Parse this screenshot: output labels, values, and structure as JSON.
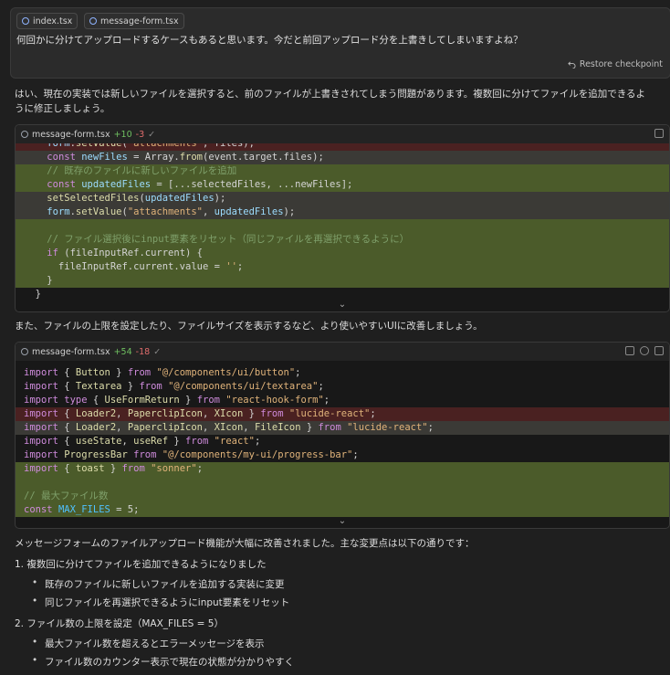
{
  "user_message": {
    "files": [
      "index.tsx",
      "message-form.tsx"
    ],
    "text": "何回かに分けてアップロードするケースもあると思います。今だと前回アップロード分を上書きしてしまいますよね？",
    "restore_label": "Restore checkpoint"
  },
  "response": {
    "para1_line1": "はい、現在の実装では新しいファイルを選択すると、前のファイルが上書きされてしまう問題があります。複数回に分けてファイルを追加できるよ",
    "para1_line2": "うに修正しましょう。",
    "para2": "また、ファイルの上限を設定したり、ファイルサイズを表示するなど、より使いやすいUIに改善しましょう。",
    "para3": "メッセージフォームのファイルアップロード機能が大幅に改善されました。主な変更点は以下の通りです：",
    "list": [
      {
        "title": "1. 複数回に分けてファイルを追加できるようになりました",
        "items": [
          "既存のファイルに新しいファイルを追加する実装に変更",
          "同じファイルを再選択できるようにinput要素をリセット"
        ]
      },
      {
        "title": "2. ファイル数の上限を設定（MAX_FILES = 5）",
        "items": [
          "最大ファイル数を超えるとエラーメッセージを表示",
          "ファイル数のカウンター表示で現在の状態が分かりやすく"
        ]
      }
    ]
  },
  "code_block_1": {
    "filename": "message-form.tsx",
    "added": "+10",
    "removed": "-3",
    "check": "✓"
  },
  "code_block_2": {
    "filename": "message-form.tsx",
    "added": "+54",
    "removed": "-18",
    "check": "✓"
  }
}
